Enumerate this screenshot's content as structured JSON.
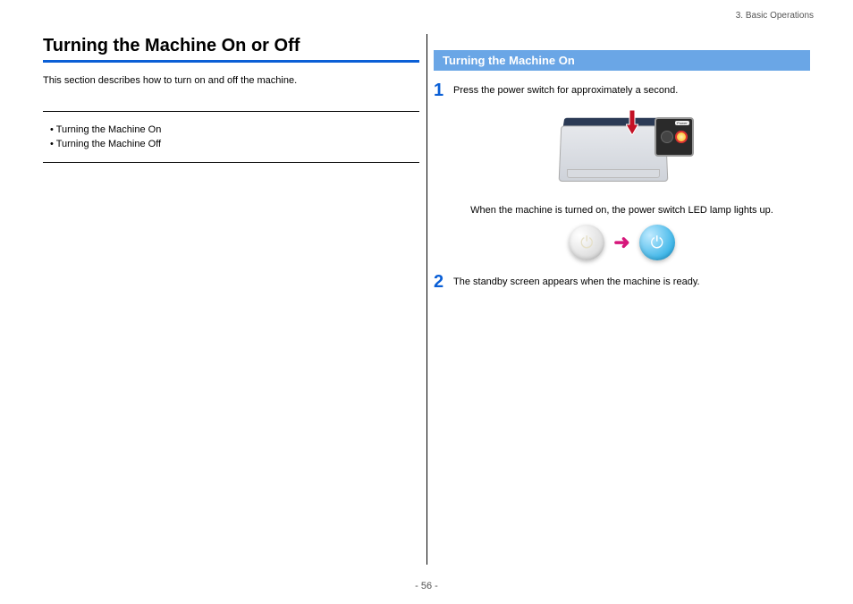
{
  "breadcrumb": "3. Basic Operations",
  "left": {
    "title": "Turning the Machine On or Off",
    "intro": "This section describes how to turn on and off the machine.",
    "toc": [
      "Turning the Machine On",
      "Turning the Machine Off"
    ]
  },
  "right": {
    "section_title": "Turning the Machine On",
    "step1_num": "1",
    "step1_text": "Press the power switch for approximately a second.",
    "panel_label": "Power",
    "note": "When the machine is turned on, the power switch LED lamp lights up.",
    "step2_num": "2",
    "step2_text": "The standby screen appears when the machine is ready."
  },
  "page_number": "- 56 -"
}
